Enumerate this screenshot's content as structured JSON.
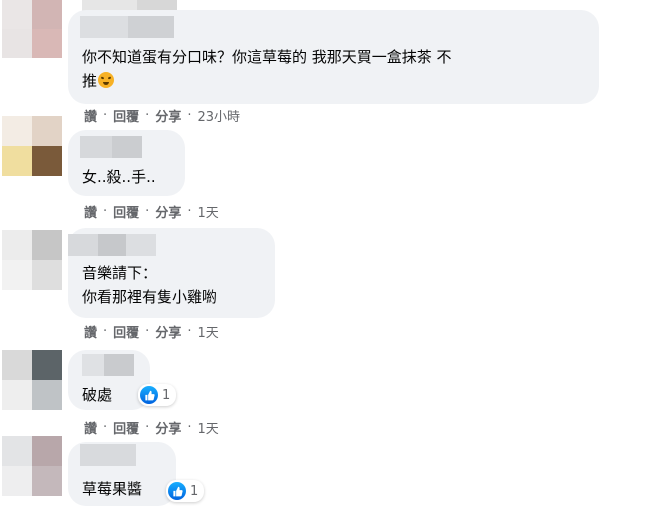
{
  "comments": [
    {
      "text_lines": [
        "你不知道蛋有分口味？你這草莓的 我那天買一盒抹茶 不",
        "推"
      ],
      "emoji": "weary-face-emoji",
      "actions": {
        "like": "讚",
        "reply": "回覆",
        "share": "分享",
        "time": "23小時"
      }
    },
    {
      "text_lines": [
        "女..殺..手.."
      ],
      "actions": {
        "like": "讚",
        "reply": "回覆",
        "share": "分享",
        "time": "1天"
      }
    },
    {
      "text_lines": [
        "音樂請下：",
        "你看那裡有隻小雞喲"
      ],
      "actions": {
        "like": "讚",
        "reply": "回覆",
        "share": "分享",
        "time": "1天"
      }
    },
    {
      "text_lines": [
        "破處"
      ],
      "reaction": {
        "icon": "thumbs-up-icon",
        "count": "1"
      },
      "actions": {
        "like": "讚",
        "reply": "回覆",
        "share": "分享",
        "time": "1天"
      }
    },
    {
      "text_lines": [
        "草莓果醬"
      ],
      "reaction": {
        "icon": "thumbs-up-icon",
        "count": "1"
      }
    }
  ],
  "separator": "·",
  "colors": {
    "bubble": "#f0f2f5",
    "meta": "#65676b",
    "like_blue": "#0866ff"
  }
}
